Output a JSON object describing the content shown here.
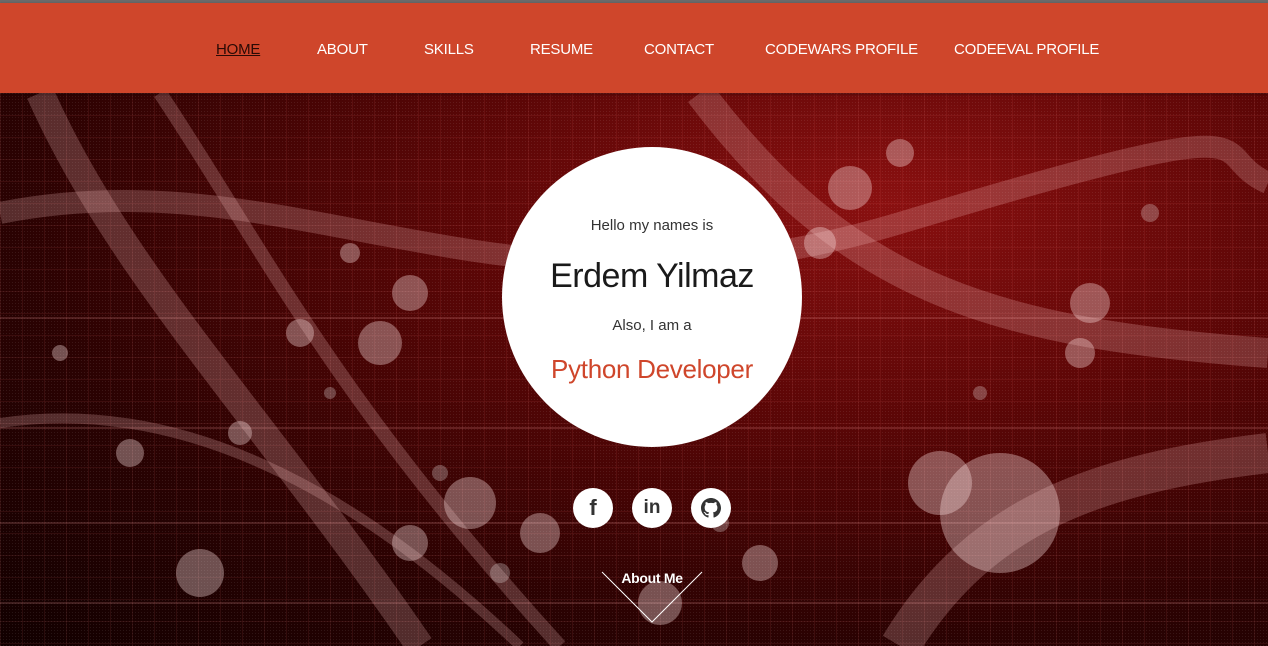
{
  "nav": {
    "items": [
      {
        "label": "HOME",
        "active": true
      },
      {
        "label": "ABOUT",
        "active": false
      },
      {
        "label": "SKILLS",
        "active": false
      },
      {
        "label": "RESUME",
        "active": false
      },
      {
        "label": "CONTACT",
        "active": false
      },
      {
        "label": "CODEWARS PROFILE",
        "active": false
      },
      {
        "label": "CODEEVAL PROFILE",
        "active": false
      }
    ]
  },
  "hero": {
    "greeting": "Hello my names is",
    "name": "Erdem Yilmaz",
    "also": "Also, I am a",
    "role": "Python Developer",
    "social": [
      {
        "icon": "facebook-icon",
        "glyph": "f"
      },
      {
        "icon": "linkedin-icon",
        "glyph": "in"
      },
      {
        "icon": "github-icon",
        "glyph": ""
      }
    ],
    "scroll_label": "About Me"
  },
  "colors": {
    "accent": "#cf462b",
    "nav_text": "#ffffff",
    "active_nav_text": "#2a0a05",
    "circle_bg": "#ffffff"
  }
}
